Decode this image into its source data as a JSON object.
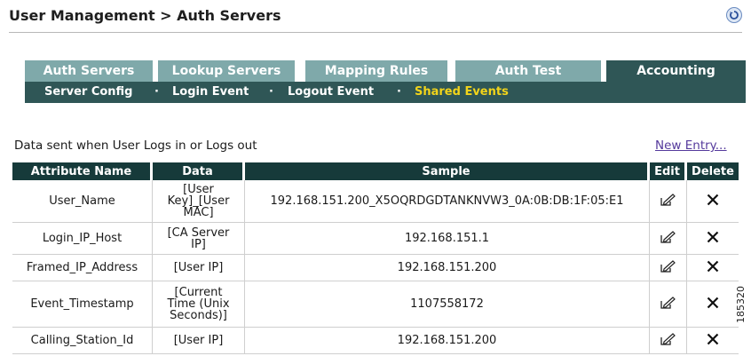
{
  "header": {
    "title": "User Management > Auth Servers"
  },
  "tabs": [
    {
      "label": "Auth Servers",
      "active": false
    },
    {
      "label": "Lookup Servers",
      "active": false
    },
    {
      "label": "Mapping Rules",
      "active": false
    },
    {
      "label": "Auth Test",
      "active": false
    },
    {
      "label": "Accounting",
      "active": true
    }
  ],
  "subnav": {
    "items": [
      {
        "label": "Server Config",
        "active": false
      },
      {
        "label": "Login Event",
        "active": false
      },
      {
        "label": "Logout Event",
        "active": false
      },
      {
        "label": "Shared Events",
        "active": true
      }
    ],
    "separator": "·"
  },
  "main": {
    "caption": "Data sent when User Logs in or Logs out",
    "new_entry_label": "New Entry..."
  },
  "table": {
    "columns": [
      "Attribute Name",
      "Data",
      "Sample",
      "Edit",
      "Delete"
    ],
    "rows": [
      {
        "attribute": "User_Name",
        "data": [
          "[User",
          "Key]_[User",
          "MAC]"
        ],
        "sample": "192.168.151.200_X5OQRDGDTANKNVW3_0A:0B:DB:1F:05:E1"
      },
      {
        "attribute": "Login_IP_Host",
        "data": [
          "[CA Server",
          "IP]"
        ],
        "sample": "192.168.151.1"
      },
      {
        "attribute": "Framed_IP_Address",
        "data": [
          "[User IP]"
        ],
        "sample": "192.168.151.200"
      },
      {
        "attribute": "Event_Timestamp",
        "data": [
          "[Current",
          "Time (Unix",
          "Seconds)]"
        ],
        "sample": "1107558172"
      },
      {
        "attribute": "Calling_Station_Id",
        "data": [
          "[User IP]"
        ],
        "sample": "192.168.151.200"
      }
    ]
  },
  "figure_id": "185320",
  "colors": {
    "tab_inactive": "#7fa9aa",
    "tab_active": "#2f5656",
    "subnav_active_text": "#f2d41a",
    "table_header": "#163a3a",
    "link": "#553a9c"
  }
}
